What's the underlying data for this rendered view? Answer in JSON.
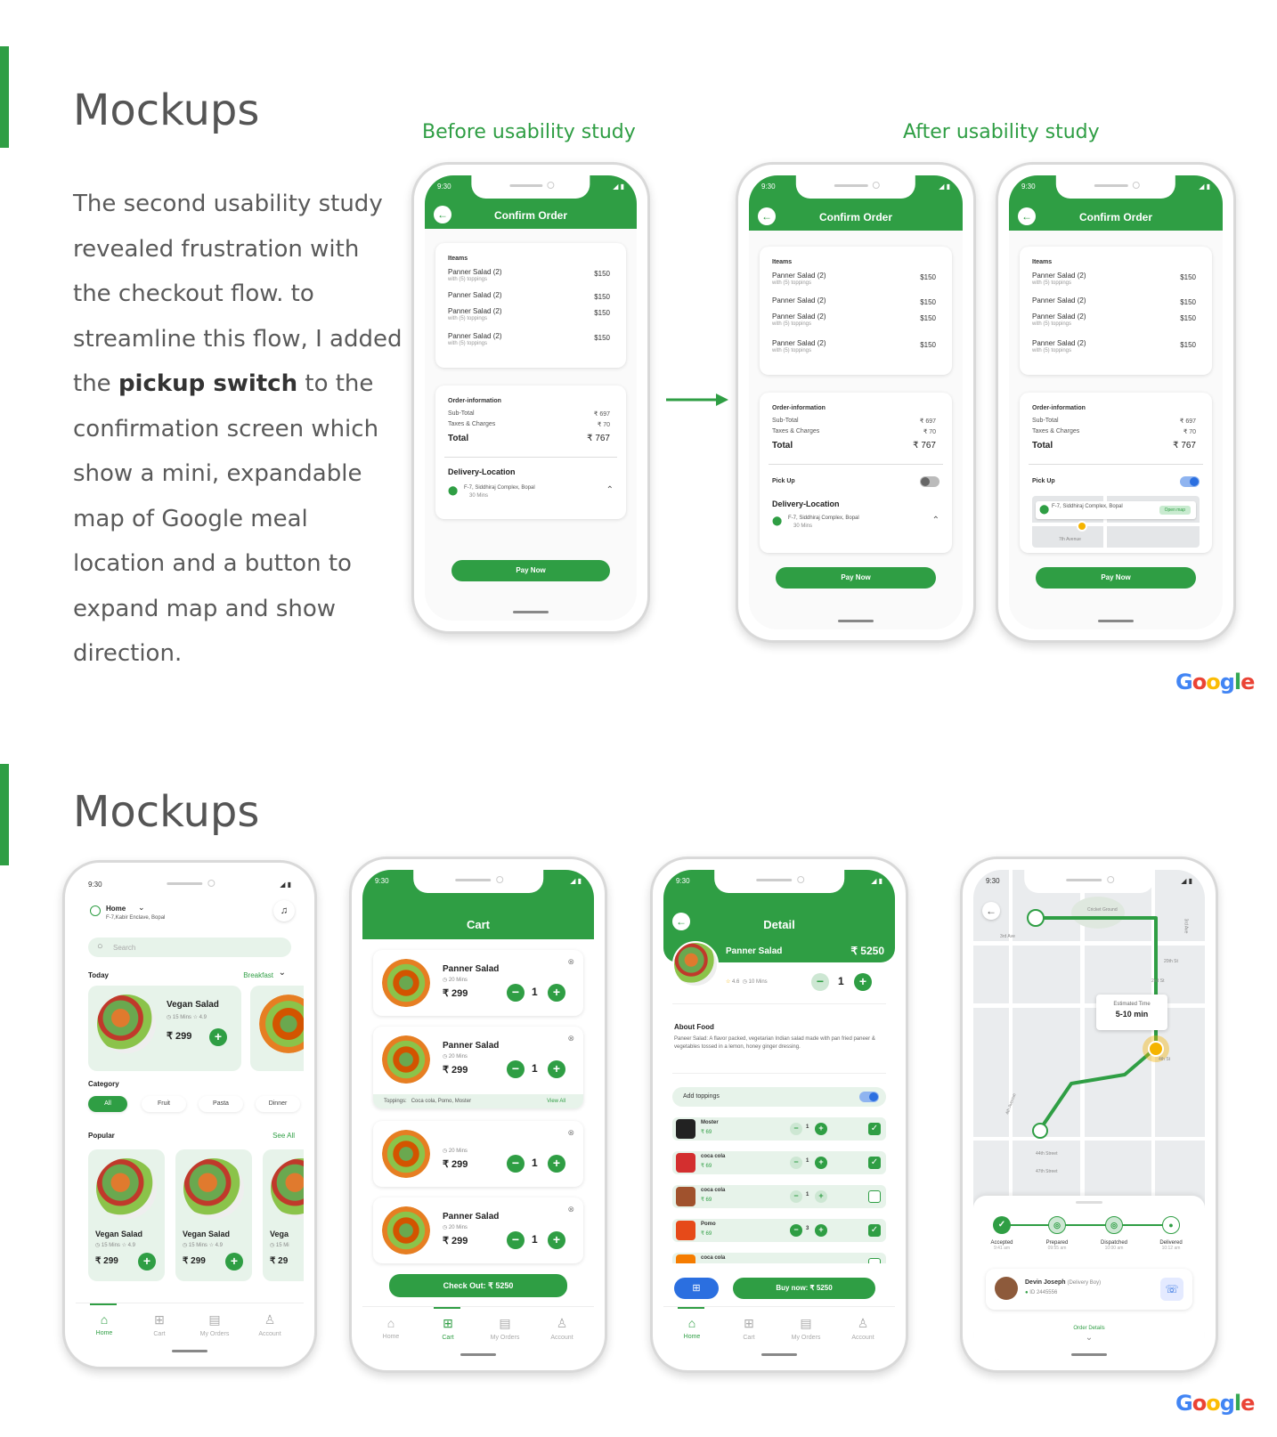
{
  "section1": {
    "title": "Mockups",
    "paragraph": {
      "before_bold": "The second usability study revealed frustration with the checkout flow. to streamline this flow, I added the ",
      "bold": "pickup switch",
      "after_bold": " to the confirmation screen which show a mini, expandable map of Google meal location and a button to expand map and show direction."
    },
    "caption_before": "Before usability study",
    "caption_after": "After usability study",
    "google_logo": "Google"
  },
  "confirm_screen": {
    "status_time": "9:30",
    "status_icons": "◢ ▮",
    "title": "Confirm Order",
    "back_icon": "arrow-left-icon",
    "items_label": "Iteams",
    "items": [
      {
        "name": "Panner Salad (2)",
        "sub": "with (5) toppings",
        "price": "$150"
      },
      {
        "name": "Panner Salad (2)",
        "sub": "",
        "price": "$150"
      },
      {
        "name": "Panner Salad (2)",
        "sub": "with (5) toppings",
        "price": "$150"
      },
      {
        "name": "Panner Salad (2)",
        "sub": "with (5) toppings",
        "price": "$150"
      }
    ],
    "order_info_label": "Order-information",
    "subtotal_label": "Sub-Total",
    "subtotal": "₹ 697",
    "taxes_label": "Taxes & Charges",
    "taxes": "₹ 70",
    "total_label": "Total",
    "total": "₹ 767",
    "delivery_label": "Delivery-Location",
    "address": "F-7, Siddhiraj Complex, Bopal",
    "address_short": "F-7, Siddhiraj Complex, Bopal",
    "eta": "30 Mins",
    "pickup_label": "Pick Up",
    "pay_label": "Pay Now",
    "map_button": "Open map",
    "map_road": "7th Avenue"
  },
  "section2": {
    "title": "Mockups",
    "google_logo": "Google"
  },
  "home_screen": {
    "time": "9:30",
    "location_title": "Home",
    "location_sub": "F-7,Kabir Enclave, Bopal",
    "search_placeholder": "Search",
    "today_label": "Today",
    "meal_select": "Breakfast",
    "featured": {
      "name": "Vegan Salad",
      "time": "15 Mins",
      "rating": "4.9",
      "price": "₹ 299"
    },
    "category_label": "Category",
    "categories": [
      "All",
      "Fruit",
      "Pasta",
      "Dinner"
    ],
    "popular_label": "Popular",
    "see_all": "See All",
    "popular": [
      {
        "name": "Vegan Salad",
        "time": "15 Mins",
        "rating": "4.9",
        "price": "₹ 299"
      },
      {
        "name": "Vegan Salad",
        "time": "15 Mins",
        "rating": "4.9",
        "price": "₹ 299"
      },
      {
        "name": "Vega",
        "time": "15 Mi",
        "price": "₹ 29"
      }
    ],
    "nav": [
      "Home",
      "Cart",
      "My Orders",
      "Account"
    ]
  },
  "cart_screen": {
    "time": "9:30",
    "title": "Cart",
    "items": [
      {
        "name": "Panner Salad",
        "time": "20 Mins",
        "price": "₹ 299",
        "qty": "1"
      },
      {
        "name": "Panner Salad",
        "time": "20 Mins",
        "price": "₹ 299",
        "qty": "1"
      },
      {
        "name": "",
        "time": "20 Mins",
        "price": "₹ 299",
        "qty": "1"
      },
      {
        "name": "Panner Salad",
        "time": "20 Mins",
        "price": "₹ 299",
        "qty": "1"
      }
    ],
    "toppings_label": "Toppings:",
    "toppings_list": "Coca cola, Pomo, Moster",
    "view_all": "View All",
    "checkout": "Check Out: ₹ 5250",
    "nav": [
      "Home",
      "Cart",
      "My Orders",
      "Account"
    ]
  },
  "detail_screen": {
    "time": "9:30",
    "title": "Detail",
    "dish": "Panner Salad",
    "price": "₹ 5250",
    "rating": "4.6",
    "duration": "10 Mins",
    "qty": "1",
    "about_label": "About Food",
    "about_text": "Paneer Salad: A flavor packed, vegetarian Indian salad made with pan fried paneer & vegetables tossed in a lemon, honey ginger dressing.",
    "add_toppings": "Add toppings",
    "toppings": [
      {
        "name": "Moster",
        "price": "₹ 69",
        "qty": "1",
        "checked": true
      },
      {
        "name": "coca cola",
        "price": "₹ 69",
        "qty": "1",
        "checked": true
      },
      {
        "name": "coca cola",
        "price": "₹ 69",
        "qty": "1",
        "checked": false
      },
      {
        "name": "Pomo",
        "price": "₹ 69",
        "qty": "3",
        "checked": true
      },
      {
        "name": "coca cola",
        "price": "",
        "qty": "",
        "checked": false
      }
    ],
    "buy_now": "Buy now: ₹ 5250",
    "nav": [
      "Home",
      "Cart",
      "My Orders",
      "Account"
    ]
  },
  "tracking_screen": {
    "time": "9:30",
    "eta_label": "Estimated Time",
    "eta_value": "5-10 min",
    "streets": [
      "3rd Ave",
      "4th Avenue",
      "44th Street",
      "47th Street",
      "4th St",
      "20th St",
      "2nd St",
      "3rd Ave",
      "Cricket Ground"
    ],
    "steps": [
      {
        "label": "Accepted",
        "time": "9:41 am"
      },
      {
        "label": "Prepared",
        "time": "09:55 am"
      },
      {
        "label": "Dispatched",
        "time": "10:00 am"
      },
      {
        "label": "Delivered",
        "time": "10:12 am"
      }
    ],
    "driver_name": "Devin Joseph",
    "driver_role": "(Delivery Boy)",
    "driver_phone": "ID 2445556",
    "order_details": "Order Details"
  }
}
